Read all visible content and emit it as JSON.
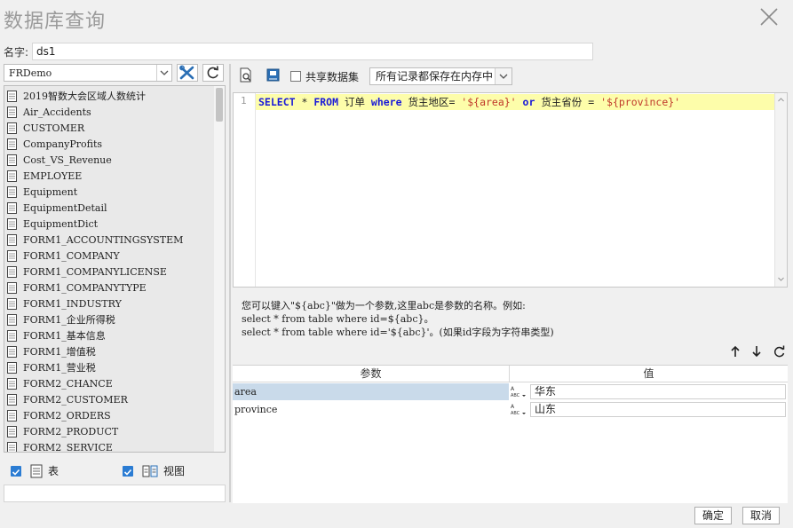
{
  "dialog": {
    "title": "数据库查询"
  },
  "name_field": {
    "label": "名字:",
    "value": "ds1"
  },
  "left": {
    "database": "FRDemo",
    "tables": [
      "2019智数大会区域人数统计",
      "Air_Accidents",
      "CUSTOMER",
      "CompanyProfits",
      "Cost_VS_Revenue",
      "EMPLOYEE",
      "Equipment",
      "EquipmentDetail",
      "EquipmentDict",
      "FORM1_ACCOUNTINGSYSTEM",
      "FORM1_COMPANY",
      "FORM1_COMPANYLICENSE",
      "FORM1_COMPANYTYPE",
      "FORM1_INDUSTRY",
      "FORM1_企业所得税",
      "FORM1_基本信息",
      "FORM1_增值税",
      "FORM1_营业税",
      "FORM2_CHANCE",
      "FORM2_CUSTOMER",
      "FORM2_ORDERS",
      "FORM2_PRODUCT",
      "FORM2_SERVICE"
    ],
    "show_tables_label": "表",
    "show_views_label": "视图"
  },
  "toolbar": {
    "share_label": "共享数据集",
    "memory_option": "所有记录都保存在内存中"
  },
  "editor": {
    "line_number": "1",
    "sql_parts": {
      "kw_select": "SELECT",
      "star": " * ",
      "kw_from": "FROM",
      "tbl": " 订单 ",
      "kw_where": "where",
      "cond1": " 货主地区= ",
      "val1": "'${area}'",
      "kw_or": " or ",
      "cond2": "货主省份 = ",
      "val2": "'${province}'"
    }
  },
  "hint": {
    "line1": "您可以键入\"${abc}\"做为一个参数,这里abc是参数的名称。例如:",
    "line2": "select * from table where id=${abc}。",
    "line3": "select * from table where id='${abc}'。(如果id字段为字符串类型)"
  },
  "params": {
    "col_param": "参数",
    "col_value": "值",
    "rows": [
      {
        "name": "area",
        "value": "华东",
        "selected": true
      },
      {
        "name": "province",
        "value": "山东",
        "selected": false
      }
    ]
  },
  "buttons": {
    "ok": "确定",
    "cancel": "取消"
  },
  "colors": {
    "accent": "#2b7cd3",
    "selected_row": "#c9daea",
    "editor_line": "#fdfdaa"
  }
}
